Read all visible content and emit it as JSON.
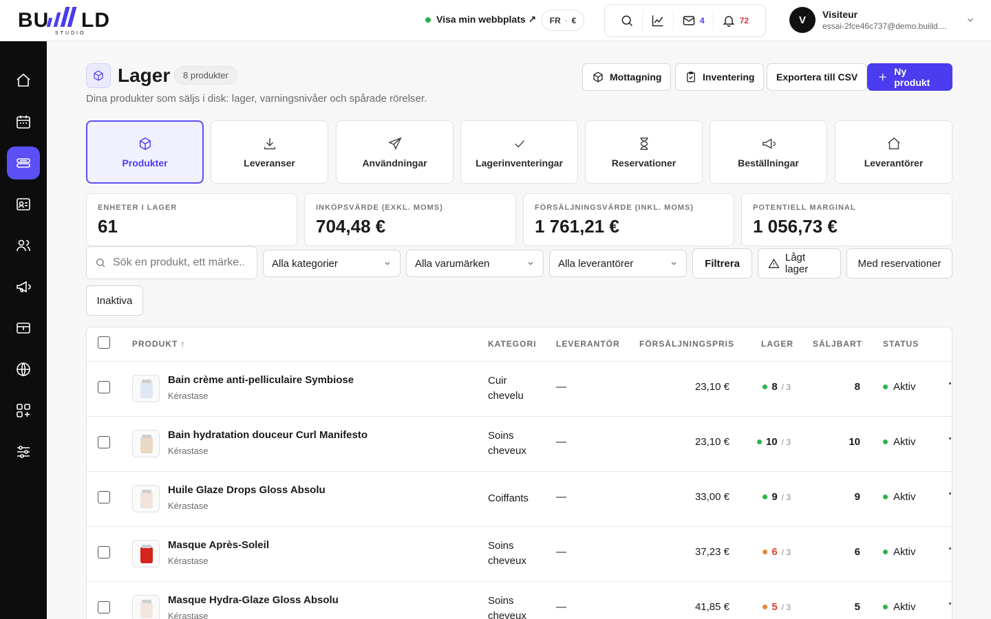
{
  "app": {
    "logo_text": "BUILD",
    "logo_sub": "STUDIO",
    "site_link": "Visa min webbplats ↗",
    "lang": "FR",
    "currency": "€",
    "messages_count": "4",
    "notifications_count": "72",
    "user": {
      "initial": "V",
      "name": "Visiteur",
      "email": "essai-2fce46c737@demo.buiild...."
    }
  },
  "header": {
    "title": "Lager",
    "count": "8 produkter",
    "subtitle": "Dina produkter som säljs i disk: lager, varningsnivåer och spårade rörelser.",
    "buttons": {
      "receiving": "Mottagning",
      "inventory": "Inventering",
      "export": "Exportera till CSV",
      "new_product": "Ny produkt"
    }
  },
  "tabs": [
    {
      "label": "Produkter",
      "icon": "box-icon",
      "active": true
    },
    {
      "label": "Leveranser",
      "icon": "download-icon"
    },
    {
      "label": "Användningar",
      "icon": "send-icon"
    },
    {
      "label": "Lagerinventeringar",
      "icon": "check-icon"
    },
    {
      "label": "Reservationer",
      "icon": "hourglass-icon"
    },
    {
      "label": "Beställningar",
      "icon": "megaphone-icon"
    },
    {
      "label": "Leverantörer",
      "icon": "home-icon"
    }
  ],
  "stats": [
    {
      "label": "ENHETER I LAGER",
      "value": "61"
    },
    {
      "label": "INKÖPSVÄRDE (EXKL. MOMS)",
      "value": "704,48 €"
    },
    {
      "label": "FÖRSÄLJNINGSVÄRDE (INKL. MOMS)",
      "value": "1 761,21 €"
    },
    {
      "label": "POTENTIELL MARGINAL",
      "value": "1 056,73 €"
    }
  ],
  "filters": {
    "search_placeholder": "Sök en produkt, ett märke...",
    "categories": "Alla kategorier",
    "brands": "Alla varumärken",
    "suppliers": "Alla leverantörer",
    "filter_button": "Filtrera",
    "low_stock": "Lågt lager",
    "with_reservations": "Med reservationer",
    "inactive": "Inaktiva"
  },
  "table": {
    "columns": {
      "product": "PRODUKT ↑",
      "category": "KATEGORI",
      "supplier": "LEVERANTÖR",
      "price": "FÖRSÄLJNINGSPRIS",
      "stock": "LAGER",
      "sellable": "SÄLJBART",
      "status": "STATUS"
    },
    "rows": [
      {
        "name": "Bain crème anti-pelliculaire Symbiose",
        "brand": "Kérastase",
        "category": "Cuir chevelu",
        "supplier": "—",
        "price": "23,10 €",
        "stock": "8",
        "min": "/ 3",
        "sellable": "8",
        "status": "Aktiv",
        "stock_color": "#2bb24c",
        "stock_text_color": "#1a1a1a",
        "thumb_color": "#dfe8f2"
      },
      {
        "name": "Bain hydratation douceur Curl Manifesto",
        "brand": "Kérastase",
        "category": "Soins cheveux",
        "supplier": "—",
        "price": "23,10 €",
        "stock": "10",
        "min": "/ 3",
        "sellable": "10",
        "status": "Aktiv",
        "stock_color": "#2bb24c",
        "stock_text_color": "#1a1a1a",
        "thumb_color": "#ead8c4"
      },
      {
        "name": "Huile Glaze Drops Gloss Absolu",
        "brand": "Kérastase",
        "category": "Coiffants",
        "supplier": "—",
        "price": "33,00 €",
        "stock": "9",
        "min": "/ 3",
        "sellable": "9",
        "status": "Aktiv",
        "stock_color": "#2bb24c",
        "stock_text_color": "#1a1a1a",
        "thumb_color": "#f1e4dc"
      },
      {
        "name": "Masque Après-Soleil",
        "brand": "Kérastase",
        "category": "Soins cheveux",
        "supplier": "—",
        "price": "37,23 €",
        "stock": "6",
        "min": "/ 3",
        "sellable": "6",
        "status": "Aktiv",
        "stock_color": "#e8883a",
        "stock_text_color": "#d9432f",
        "thumb_color": "#d4241c"
      },
      {
        "name": "Masque Hydra-Glaze Gloss Absolu",
        "brand": "Kérastase",
        "category": "Soins cheveux",
        "supplier": "—",
        "price": "41,85 €",
        "stock": "5",
        "min": "/ 3",
        "sellable": "5",
        "status": "Aktiv",
        "stock_color": "#e8883a",
        "stock_text_color": "#d9432f",
        "thumb_color": "#f3e6df"
      }
    ]
  },
  "colors": {
    "accent": "#4b3cf0",
    "active_tab_bg": "#f1f0ff",
    "sidebar": "#0d0d0d",
    "ok": "#2bb24c",
    "warn": "#e8883a"
  }
}
